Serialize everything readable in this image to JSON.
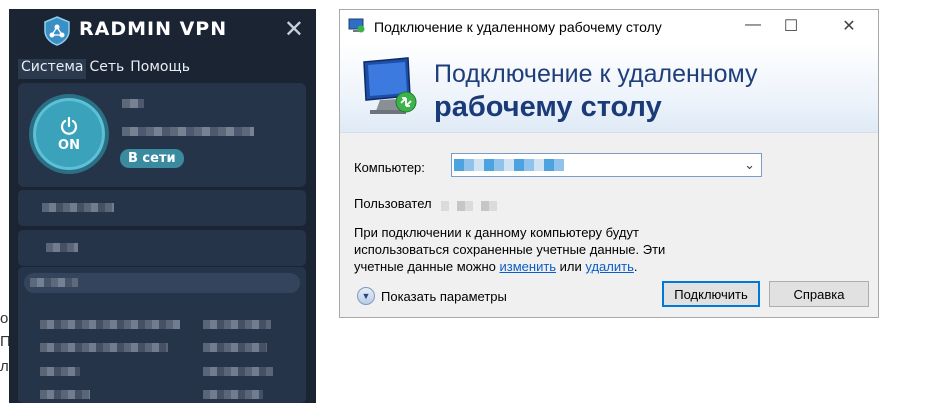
{
  "background": {
    "fragments": [
      "ок",
      "П",
      "ле"
    ]
  },
  "radmin": {
    "brand": "RADMIN VPN",
    "menu": [
      "Система",
      "Сеть",
      "Помощь"
    ],
    "power_label": "ON",
    "status": "В сети",
    "close_glyph": "✕"
  },
  "rdp": {
    "title": "Подключение к удаленному рабочему столу",
    "header_line1": "Подключение к удаленному",
    "header_line2": "рабочему столу",
    "computer_label": "Компьютер:",
    "user_label": "Пользовател",
    "info_line1": "При подключении к данному компьютеру будут",
    "info_line2": "использоваться сохраненные учетные данные.  Эти",
    "info_line3_pre": "учетные данные можно ",
    "info_link_change": "изменить",
    "info_line3_mid": " или ",
    "info_link_delete": "удалить",
    "info_line3_post": ".",
    "show_options": "Показать параметры",
    "connect_button": "Подключить",
    "help_button": "Справка",
    "window_controls": {
      "minimize": "—",
      "maximize": "☐",
      "close": "✕"
    }
  }
}
